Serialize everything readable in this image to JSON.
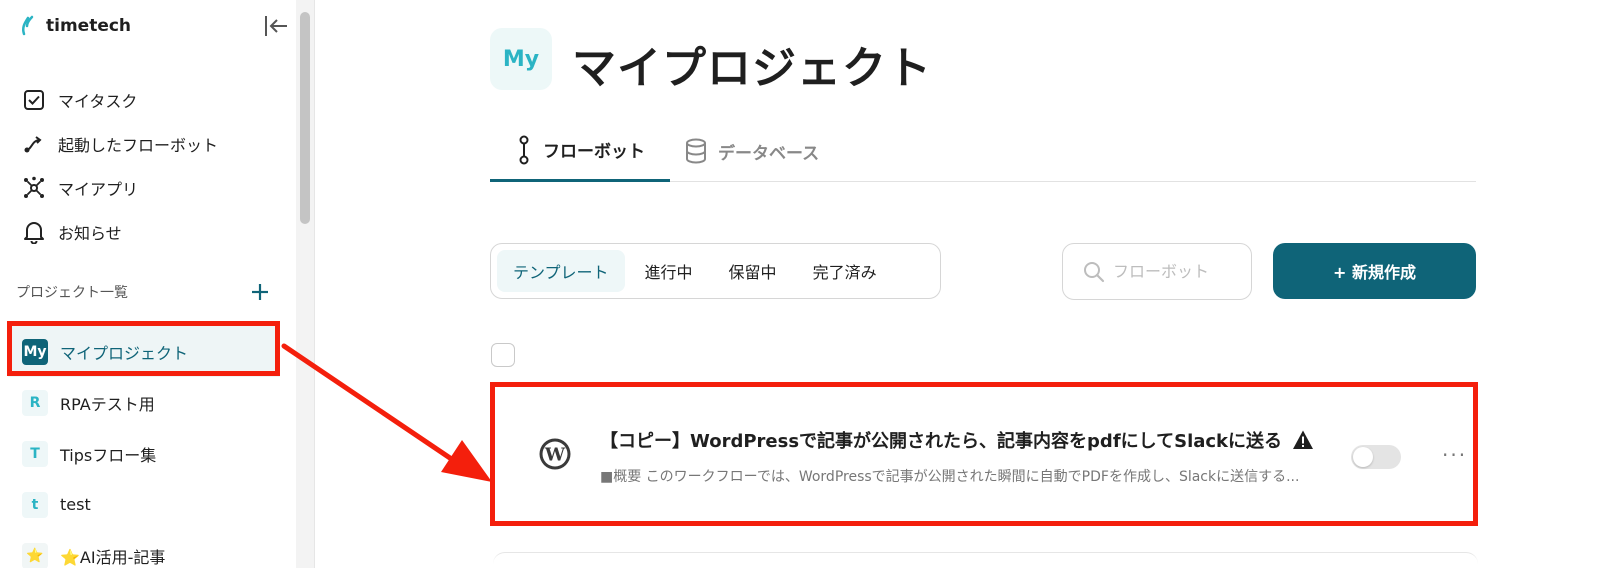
{
  "brand": {
    "name": "timetech"
  },
  "sidebar": {
    "nav": [
      {
        "label": "マイタスク",
        "icon": "check-square-icon"
      },
      {
        "label": "起動したフローボット",
        "icon": "flow-route-icon"
      },
      {
        "label": "マイアプリ",
        "icon": "app-network-icon"
      },
      {
        "label": "お知らせ",
        "icon": "bell-icon"
      }
    ],
    "projects_header": "プロジェクト一覧",
    "projects": [
      {
        "badge": "My",
        "label": "マイプロジェクト",
        "active": true
      },
      {
        "badge": "R",
        "label": "RPAテスト用"
      },
      {
        "badge": "T",
        "label": "Tipsフロー集"
      },
      {
        "badge": "t",
        "label": "test"
      },
      {
        "badge": "⭐",
        "label": "⭐AI活用-記事"
      }
    ]
  },
  "main": {
    "avatar": "My",
    "title": "マイプロジェクト",
    "tabs": [
      {
        "label": "フローボット",
        "active": true
      },
      {
        "label": "データベース"
      }
    ],
    "filters": [
      {
        "label": "テンプレート",
        "active": true
      },
      {
        "label": "進行中"
      },
      {
        "label": "保留中"
      },
      {
        "label": "完了済み"
      }
    ],
    "search": {
      "placeholder": "フローボット"
    },
    "create_label": "+ 新規作成",
    "flow": {
      "title": "【コピー】WordPressで記事が公開されたら、記事内容をpdfにしてSlackに送る",
      "description": "■概要 このワークフローでは、WordPressで記事が公開された瞬間に自動でPDFを作成し、Slackに送信する...",
      "more": "···"
    }
  },
  "colors": {
    "primary": "#0f6478",
    "accent": "#2bb4c4",
    "annotation": "#f41f0c"
  }
}
